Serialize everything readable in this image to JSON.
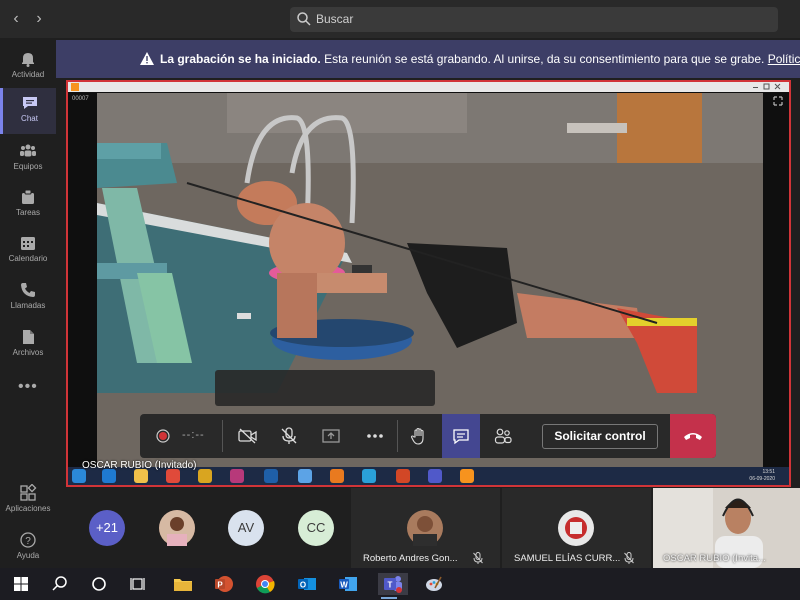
{
  "topbar": {
    "search_placeholder": "Buscar"
  },
  "rail": {
    "items": [
      {
        "label": "Actividad",
        "icon": "bell-icon"
      },
      {
        "label": "Chat",
        "icon": "chat-icon"
      },
      {
        "label": "Equipos",
        "icon": "teams-icon"
      },
      {
        "label": "Tareas",
        "icon": "tasks-icon"
      },
      {
        "label": "Calendario",
        "icon": "calendar-icon"
      },
      {
        "label": "Llamadas",
        "icon": "phone-icon"
      },
      {
        "label": "Archivos",
        "icon": "files-icon"
      }
    ],
    "more": "•••",
    "apps_label": "Aplicaciones",
    "help_label": "Ayuda"
  },
  "banner": {
    "title": "La grabación se ha iniciado.",
    "text": "Esta reunión se está grabando. Al unirse, da su consentimiento para que se grabe.",
    "link": "Política de p"
  },
  "share": {
    "frame_number": "00007",
    "presenter": "OSCAR RUBIO (Invitado)",
    "clock_time": "13:51",
    "clock_date": "06-09-2020"
  },
  "controls": {
    "timer": "--:--",
    "request_control": "Solicitar control"
  },
  "participants": {
    "more_count": "+21",
    "initials": [
      "AV",
      "CC"
    ],
    "named": [
      {
        "name": "Roberto Andres Gon..."
      },
      {
        "name": "SAMUEL ELÍAS CURR..."
      },
      {
        "name": "OSCAR RUBIO (Invita..."
      }
    ]
  },
  "colors": {
    "accent": "#444791",
    "banner": "#3d3e66",
    "hangup": "#c4314b",
    "share_border": "#d13438"
  }
}
